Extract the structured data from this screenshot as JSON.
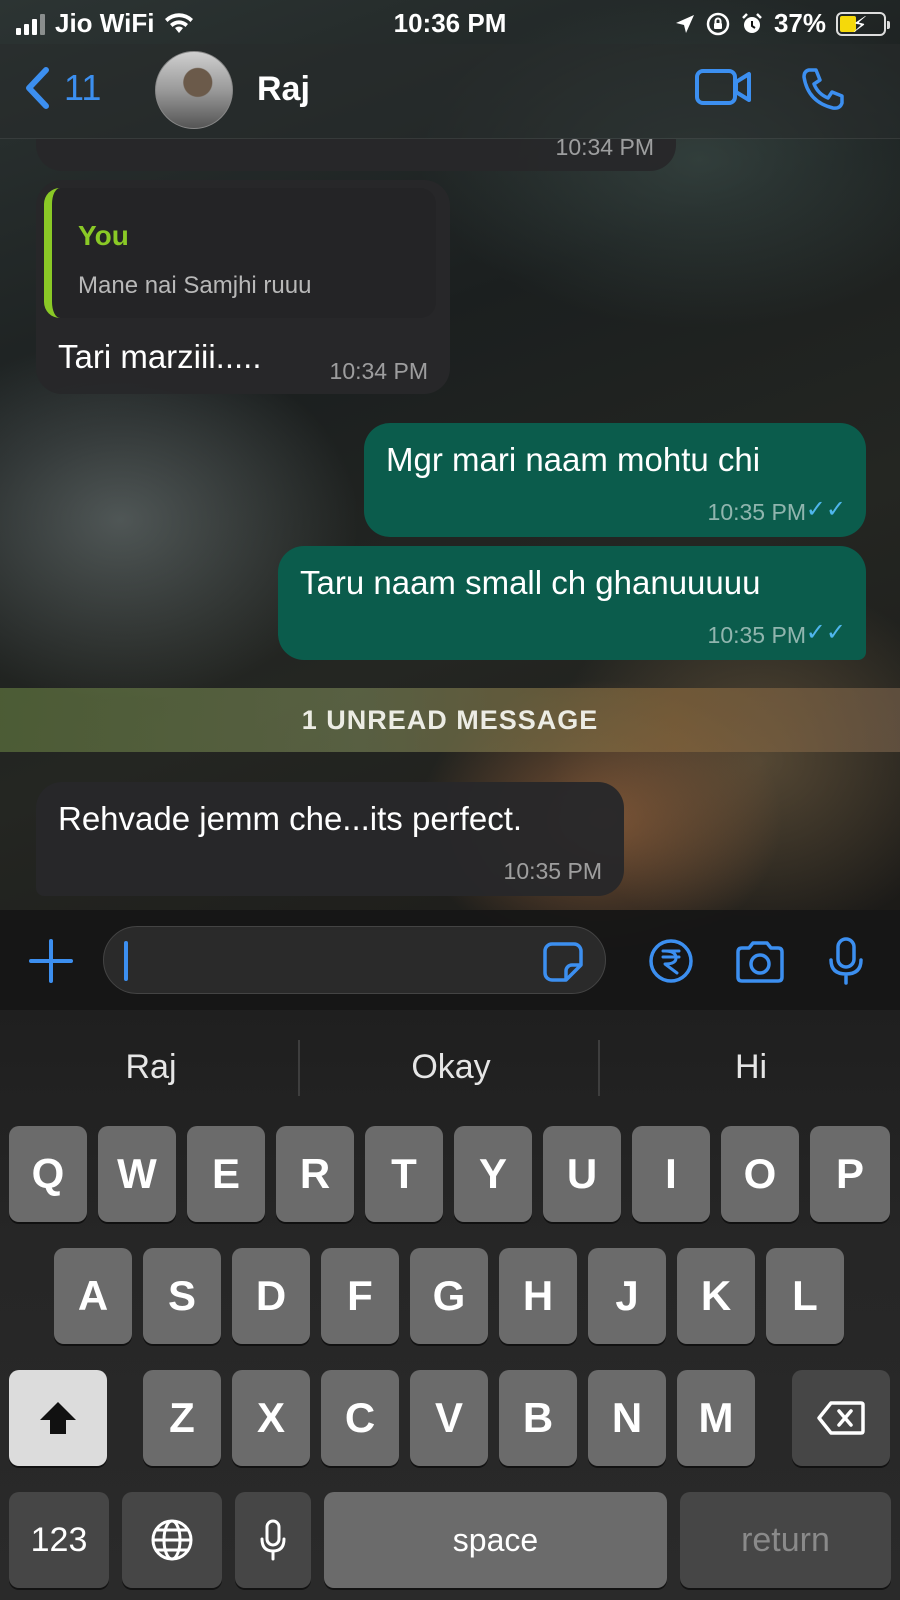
{
  "status_bar": {
    "carrier": "Jio WiFi",
    "time": "10:36 PM",
    "battery": "37%"
  },
  "header": {
    "back_count": "11",
    "contact_name": "Raj"
  },
  "messages": {
    "top_partial_time": "10:34 PM",
    "reply": {
      "quote_author": "You",
      "quote_text": "Mane nai Samjhi ruuu",
      "text": "Tari marziii.....",
      "time": "10:34 PM"
    },
    "out1": {
      "text": "Mgr mari naam mohtu chi",
      "time": "10:35 PM"
    },
    "out2": {
      "text": "Taru naam small ch ghanuuuuu",
      "time": "10:35 PM"
    },
    "unread_label": "1 UNREAD MESSAGE",
    "in_last": {
      "text": "Rehvade jemm che...its perfect.",
      "time": "10:35 PM"
    }
  },
  "keyboard": {
    "suggestions": [
      "Raj",
      "Okay",
      "Hi"
    ],
    "row1": [
      "Q",
      "W",
      "E",
      "R",
      "T",
      "Y",
      "U",
      "I",
      "O",
      "P"
    ],
    "row2": [
      "A",
      "S",
      "D",
      "F",
      "G",
      "H",
      "J",
      "K",
      "L"
    ],
    "row3": [
      "Z",
      "X",
      "C",
      "V",
      "B",
      "N",
      "M"
    ],
    "num_key": "123",
    "space": "space",
    "return": "return"
  },
  "colors": {
    "accent": "#3c8ff0",
    "outgoing_bubble": "#0b5c4c",
    "incoming_bubble": "#28282a",
    "quote_accent": "#8ac926",
    "read_ticks": "#4fb6ec"
  }
}
